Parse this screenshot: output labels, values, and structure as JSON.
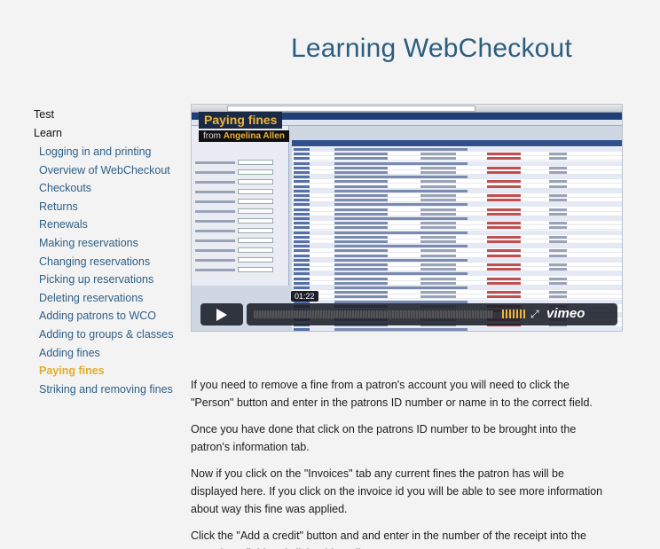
{
  "page": {
    "title": "Learning WebCheckout"
  },
  "sidebar": {
    "top_items": [
      {
        "label": "Test"
      },
      {
        "label": "Learn"
      }
    ],
    "learn_items": [
      {
        "label": "Logging in and printing"
      },
      {
        "label": "Overview of WebCheckout"
      },
      {
        "label": "Checkouts"
      },
      {
        "label": "Returns"
      },
      {
        "label": "Renewals"
      },
      {
        "label": "Making reservations"
      },
      {
        "label": "Changing reservations"
      },
      {
        "label": "Picking up reservations"
      },
      {
        "label": "Deleting reservations"
      },
      {
        "label": "Adding patrons to WCO"
      },
      {
        "label": "Adding to groups & classes"
      },
      {
        "label": "Adding fines"
      },
      {
        "label": "Paying fines",
        "active": true
      },
      {
        "label": "Striking and removing fines"
      }
    ],
    "active_color": "#e1ad2b",
    "link_color": "#2e5f86"
  },
  "video": {
    "title": "Paying fines",
    "from_label": "from",
    "author": "Angelina Allen",
    "time": "01:22",
    "provider": "vimeo",
    "play_icon": "play-icon",
    "volume_icon": "volume-icon",
    "fullscreen_icon": "fullscreen-icon",
    "progress_fraction": 0.0
  },
  "content": {
    "paragraphs": [
      "If you need to remove a fine from a patron's account you will need to click the \"Person\" button and enter in the patrons ID number or name in to the correct field.",
      "Once you have done that click on the patrons ID number to be brought into the patron's information tab.",
      "Now if you click on the \"Invoices\" tab any current fines the patron has will be displayed here. If you click on the invoice id you will be able to see more information about way this fine was applied.",
      "Click the \"Add a credit\" button and and enter in the number of the receipt into the \"Receipt#\" field and click add credit."
    ]
  }
}
